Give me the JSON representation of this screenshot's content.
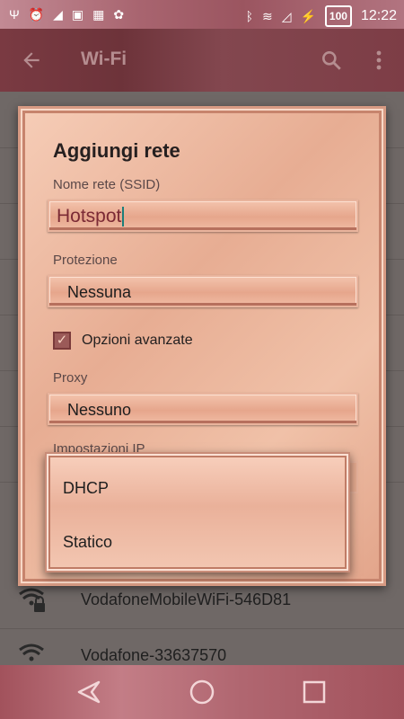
{
  "status_bar": {
    "battery": "100",
    "time": "12:22",
    "icons": [
      "usb-icon",
      "alarm-icon",
      "sim-icon",
      "gallery-icon",
      "calendar-icon",
      "android-icon",
      "bluetooth-icon",
      "wifi-signal-icon",
      "no-sim-icon",
      "charging-icon"
    ]
  },
  "app_bar": {
    "title": "Wi-Fi"
  },
  "dialog": {
    "title": "Aggiungi rete",
    "ssid_label": "Nome rete (SSID)",
    "ssid_value": "Hotspot",
    "security_label": "Protezione",
    "security_value": "Nessuna",
    "advanced_label": "Opzioni avanzate",
    "advanced_checked": true,
    "proxy_label": "Proxy",
    "proxy_value": "Nessuno",
    "ip_label": "Impostazioni IP"
  },
  "ip_dropdown": {
    "options": [
      "DHCP",
      "Statico"
    ]
  },
  "networks": [
    {
      "name": "VodafoneMobileWiFi-546D81"
    },
    {
      "name": "Vodafone-33637570"
    }
  ],
  "colors": {
    "accent": "#1c7f7a",
    "dialog_bg": "#f0c1a8",
    "app_bar": "#7a3a42"
  }
}
